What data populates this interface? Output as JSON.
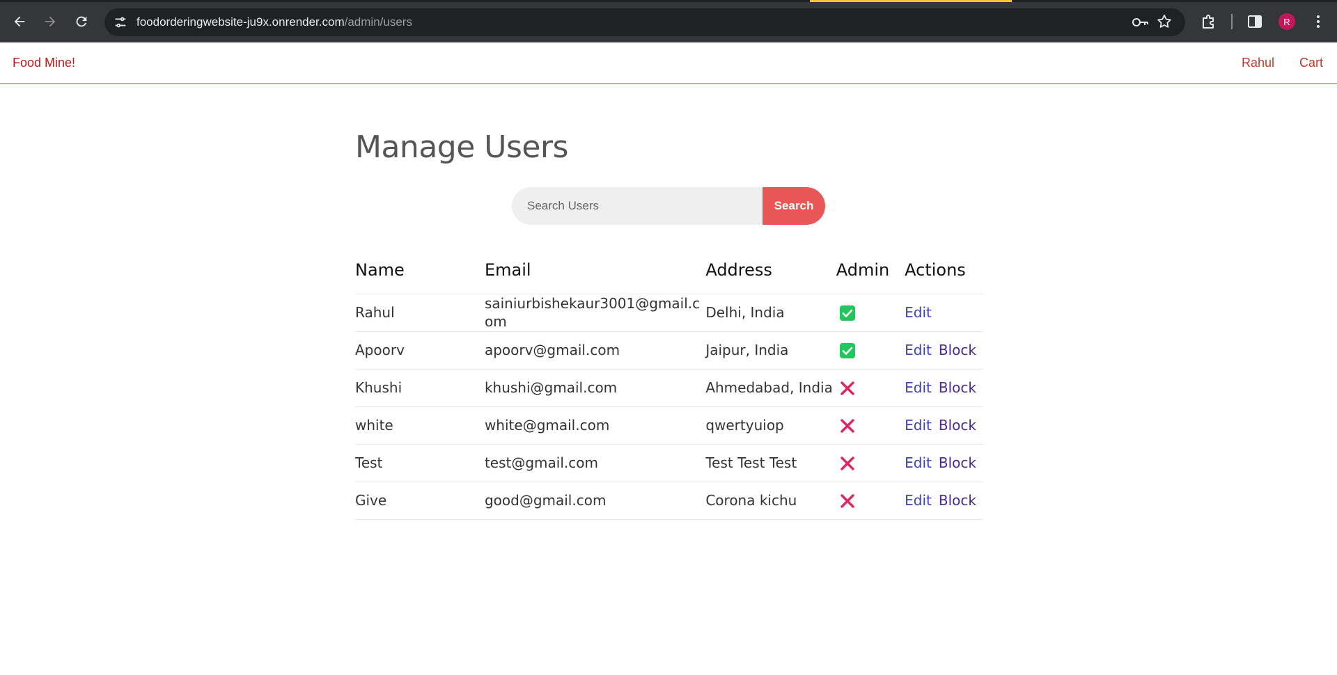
{
  "browser": {
    "url_host": "foodorderingwebsite-ju9x.onrender.com",
    "url_path": "/admin/users",
    "profile_initial": "R"
  },
  "header": {
    "brand": "Food Mine!",
    "user_link": "Rahul",
    "cart_link": "Cart"
  },
  "page": {
    "title": "Manage Users"
  },
  "search": {
    "placeholder": "Search Users",
    "button_label": "Search"
  },
  "table": {
    "columns": [
      "Name",
      "Email",
      "Address",
      "Admin",
      "Actions"
    ],
    "rows": [
      {
        "name": "Rahul",
        "email": "sainiurbishekaur3001@gmail.com",
        "address": "Delhi, India",
        "admin": true,
        "edit": "Edit",
        "block": ""
      },
      {
        "name": "Apoorv",
        "email": "apoorv@gmail.com",
        "address": "Jaipur, India",
        "admin": true,
        "edit": "Edit",
        "block": "Block"
      },
      {
        "name": "Khushi",
        "email": "khushi@gmail.com",
        "address": "Ahmedabad, India",
        "admin": false,
        "edit": "Edit",
        "block": "Block"
      },
      {
        "name": "white",
        "email": "white@gmail.com",
        "address": "qwertyuiop",
        "admin": false,
        "edit": "Edit",
        "block": "Block"
      },
      {
        "name": "Test",
        "email": "test@gmail.com",
        "address": "Test Test Test",
        "admin": false,
        "edit": "Edit",
        "block": "Block"
      },
      {
        "name": "Give",
        "email": "good@gmail.com",
        "address": "Corona kichu",
        "admin": false,
        "edit": "Edit",
        "block": "Block"
      }
    ]
  },
  "colors": {
    "accent_red": "#e95656",
    "admin_yes": "#22c55e",
    "admin_no": "#e0245e",
    "link": "#3f3fbf"
  }
}
